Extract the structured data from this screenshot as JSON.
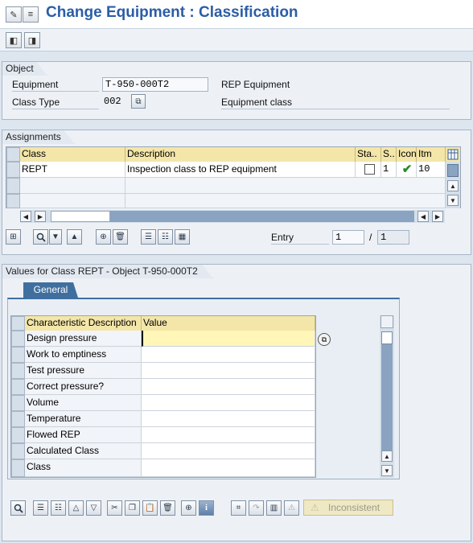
{
  "window": {
    "title": "Change Equipment : Classification"
  },
  "toolbar": {
    "icons": [
      "display-change-icon",
      "doc-icon",
      "previous-screen-icon",
      "next-screen-icon"
    ]
  },
  "object": {
    "heading": "Object",
    "equipment_label": "Equipment",
    "equipment_value": "T-950-000T2",
    "equipment_desc": "REP Equipment",
    "class_type_label": "Class Type",
    "class_type_value": "002",
    "class_type_desc": "Equipment class"
  },
  "assignments": {
    "heading": "Assignments",
    "columns": [
      "Class",
      "Description",
      "Sta..",
      "S..",
      "Icon",
      "Itm"
    ],
    "rows": [
      {
        "class": "REPT",
        "description": "Inspection class to REP equipment",
        "s": "1",
        "itm": "10"
      }
    ],
    "entry_label": "Entry",
    "entry_value": "1",
    "entry_sep": "/",
    "entry_total": "1"
  },
  "values": {
    "heading": "Values for Class REPT - Object T-950-000T2",
    "tab_general": "General",
    "col_char": "Characteristic Description",
    "col_value": "Value",
    "characteristics": [
      "Design pressure",
      "Work to emptiness",
      "Test pressure",
      "Correct pressure?",
      "Volume",
      "Temperature",
      "Flowed REP",
      "Calculated Class",
      "Class"
    ],
    "inconsistent_label": "Inconsistent"
  }
}
